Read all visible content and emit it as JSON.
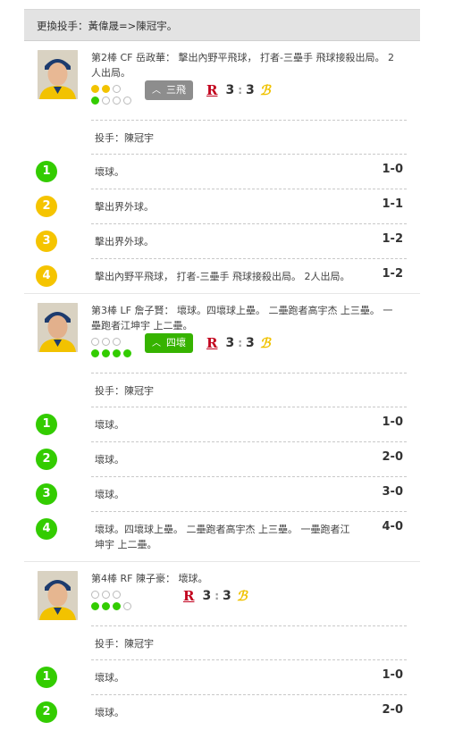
{
  "header": {
    "text": "更換投手：黃偉晟=>陳冠宇。"
  },
  "plays": [
    {
      "description": "第2棒 CF 岳政華： 擊出內野平飛球， 打者-三壘手 飛球接殺出局。 2人出局。",
      "outs": 2,
      "balls": 1,
      "result": {
        "label": "三飛",
        "color": "gray"
      },
      "score": {
        "away": "3",
        "home": "3"
      },
      "pitcher": "投手：陳冠宇",
      "pitches": [
        {
          "num": "1",
          "color": "green",
          "text": "壞球。",
          "count": "1-0"
        },
        {
          "num": "2",
          "color": "yellow",
          "text": "擊出界外球。",
          "count": "1-1"
        },
        {
          "num": "3",
          "color": "yellow",
          "text": "擊出界外球。",
          "count": "1-2"
        },
        {
          "num": "4",
          "color": "yellow",
          "text": "擊出內野平飛球， 打者-三壘手 飛球接殺出局。 2人出局。",
          "count": "1-2"
        }
      ]
    },
    {
      "description": "第3棒 LF 詹子賢： 壞球。四壞球上壘。 二壘跑者高宇杰 上三壘。 一壘跑者江坤宇 上二壘。",
      "outs": 0,
      "balls": 4,
      "result": {
        "label": "四壞",
        "color": "green"
      },
      "score": {
        "away": "3",
        "home": "3"
      },
      "pitcher": "投手：陳冠宇",
      "pitches": [
        {
          "num": "1",
          "color": "green",
          "text": "壞球。",
          "count": "1-0"
        },
        {
          "num": "2",
          "color": "green",
          "text": "壞球。",
          "count": "2-0"
        },
        {
          "num": "3",
          "color": "green",
          "text": "壞球。",
          "count": "3-0"
        },
        {
          "num": "4",
          "color": "green",
          "text": "壞球。四壞球上壘。 二壘跑者高宇杰 上三壘。 一壘跑者江坤宇 上二壘。",
          "count": "4-0"
        }
      ]
    },
    {
      "description": "第4棒 RF 陳子豪： 壞球。",
      "outs": 0,
      "balls": 3,
      "result": null,
      "score": {
        "away": "3",
        "home": "3"
      },
      "pitcher": "投手：陳冠宇",
      "pitches": [
        {
          "num": "1",
          "color": "green",
          "text": "壞球。",
          "count": "1-0"
        },
        {
          "num": "2",
          "color": "green",
          "text": "壞球。",
          "count": "2-0"
        }
      ]
    }
  ],
  "icons": {
    "team_home": "R-logo-icon",
    "team_away": "brothers-logo-icon",
    "result_chevron": "chevron-up-icon"
  },
  "colors": {
    "ball": "#33cc00",
    "out": "#f2c300",
    "strike_pitch": "#f5c400",
    "result_gray": "#8d8d8d",
    "result_green": "#36b300",
    "home_logo": "#c2001d"
  }
}
